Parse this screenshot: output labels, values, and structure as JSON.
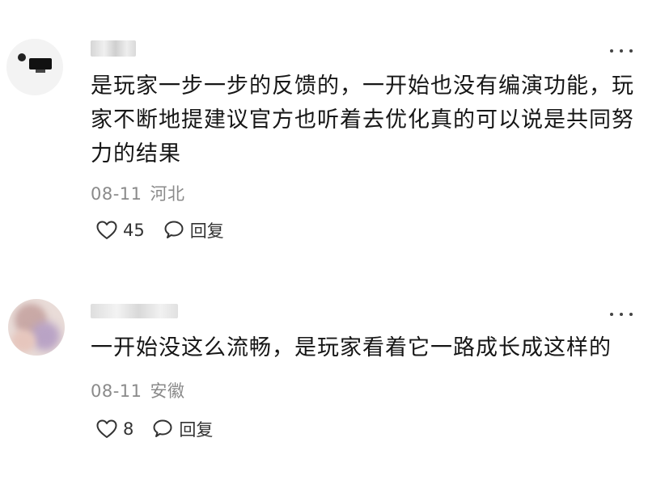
{
  "comments": [
    {
      "text": "是玩家一步一步的反馈的，一开始也没有编演功能，玩家不断地提建议官方也听着去优化真的可以说是共同努力的结果",
      "date": "08-11",
      "location": "河北",
      "likes": "45",
      "reply_label": "回复"
    },
    {
      "text": "一开始没这么流畅，是玩家看着它一路成长成这样的",
      "date": "08-11",
      "location": "安徽",
      "likes": "8",
      "reply_label": "回复"
    }
  ],
  "icons": {
    "more": "more-dots-icon",
    "like": "heart-icon",
    "reply": "speech-bubble-icon"
  }
}
